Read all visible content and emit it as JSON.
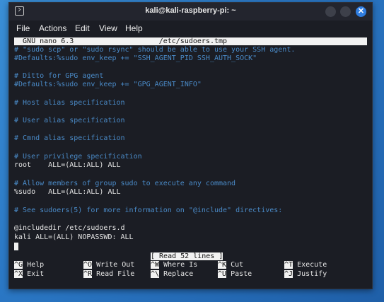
{
  "window": {
    "title": "kali@kali-raspberry-pi: ~",
    "close_glyph": "✕"
  },
  "menu": [
    "File",
    "Actions",
    "Edit",
    "View",
    "Help"
  ],
  "nano": {
    "header": "  GNU nano 6.3                    /etc/sudoers.tmp                     ",
    "lines": [
      {
        "text": "# \"sudo scp\" or \"sudo rsync\" should be able to use your SSH agent.",
        "kind": "comment"
      },
      {
        "text": "#Defaults:%sudo env_keep += \"SSH_AGENT_PID SSH_AUTH_SOCK\"",
        "kind": "comment"
      },
      {
        "text": "",
        "kind": "plain"
      },
      {
        "text": "# Ditto for GPG agent",
        "kind": "comment"
      },
      {
        "text": "#Defaults:%sudo env_keep += \"GPG_AGENT_INFO\"",
        "kind": "comment"
      },
      {
        "text": "",
        "kind": "plain"
      },
      {
        "text": "# Host alias specification",
        "kind": "comment"
      },
      {
        "text": "",
        "kind": "plain"
      },
      {
        "text": "# User alias specification",
        "kind": "comment"
      },
      {
        "text": "",
        "kind": "plain"
      },
      {
        "text": "# Cmnd alias specification",
        "kind": "comment"
      },
      {
        "text": "",
        "kind": "plain"
      },
      {
        "text": "# User privilege specification",
        "kind": "comment"
      },
      {
        "text": "root    ALL=(ALL:ALL) ALL",
        "kind": "plain"
      },
      {
        "text": "",
        "kind": "plain"
      },
      {
        "text": "# Allow members of group sudo to execute any command",
        "kind": "comment"
      },
      {
        "text": "%sudo   ALL=(ALL:ALL) ALL",
        "kind": "plain"
      },
      {
        "text": "",
        "kind": "plain"
      },
      {
        "text": "# See sudoers(5) for more information on \"@include\" directives:",
        "kind": "comment"
      },
      {
        "text": "",
        "kind": "plain"
      },
      {
        "text": "@includedir /etc/sudoers.d",
        "kind": "plain"
      },
      {
        "text": "kali ALL=(ALL) NOPASSWD: ALL",
        "kind": "plain"
      }
    ],
    "status": "[ Read 52 lines ]",
    "shortcuts": [
      {
        "key": "^G",
        "label": "Help"
      },
      {
        "key": "^O",
        "label": "Write Out"
      },
      {
        "key": "^W",
        "label": "Where Is"
      },
      {
        "key": "^K",
        "label": "Cut"
      },
      {
        "key": "^T",
        "label": "Execute"
      },
      {
        "key": "^X",
        "label": "Exit"
      },
      {
        "key": "^R",
        "label": "Read File"
      },
      {
        "key": "^\\",
        "label": "Replace"
      },
      {
        "key": "^U",
        "label": "Paste"
      },
      {
        "key": "^J",
        "label": "Justify"
      }
    ]
  }
}
